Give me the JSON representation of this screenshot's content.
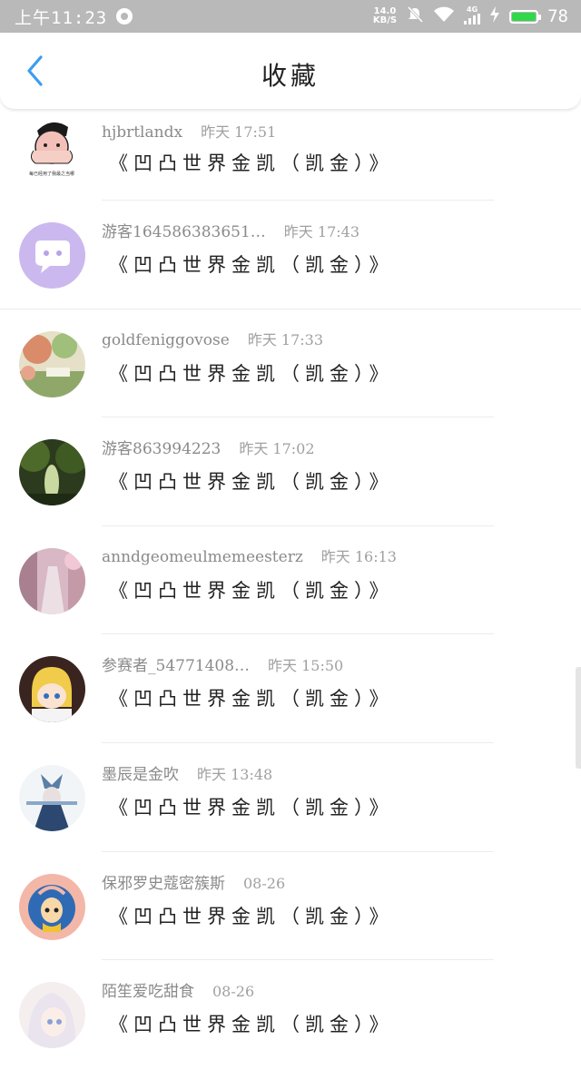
{
  "status_bar": {
    "time": "上午11:23",
    "net_speed_value": "14.0",
    "net_speed_unit": "KB/S",
    "network_type": "4G",
    "battery_level": "78",
    "battery_fill_color": "#30d84a"
  },
  "header": {
    "back_icon": "chevron-left-icon",
    "back_color": "#3a9df0",
    "title": "收藏"
  },
  "favorites": [
    {
      "username": "hjbrtlandx",
      "time": "昨天 17:51",
      "title": "《凹凸世界金凯（凯金）》",
      "avatar_caption": "每已经用了我最之当哪"
    },
    {
      "username": "游客164586383651…",
      "time": "昨天 17:43",
      "title": "《凹凸世界金凯（凯金）》"
    },
    {
      "username": "goldfeniggovose",
      "time": "昨天 17:33",
      "title": "《凹凸世界金凯（凯金）》"
    },
    {
      "username": "游客863994223",
      "time": "昨天 17:02",
      "title": "《凹凸世界金凯（凯金）》"
    },
    {
      "username": "anndgeomeulmemeesterz",
      "time": "昨天 16:13",
      "title": "《凹凸世界金凯（凯金）》"
    },
    {
      "username": "参赛者_54771408…",
      "time": "昨天 15:50",
      "title": "《凹凸世界金凯（凯金）》"
    },
    {
      "username": "墨辰是金吹",
      "time": "昨天 13:48",
      "title": "《凹凸世界金凯（凯金）》"
    },
    {
      "username": "保邪罗史蔻密簇斯",
      "time": "08-26",
      "title": "《凹凸世界金凯（凯金）》"
    },
    {
      "username": "陌笙爱吃甜食",
      "time": "08-26",
      "title": "《凹凸世界金凯（凯金）》"
    }
  ]
}
